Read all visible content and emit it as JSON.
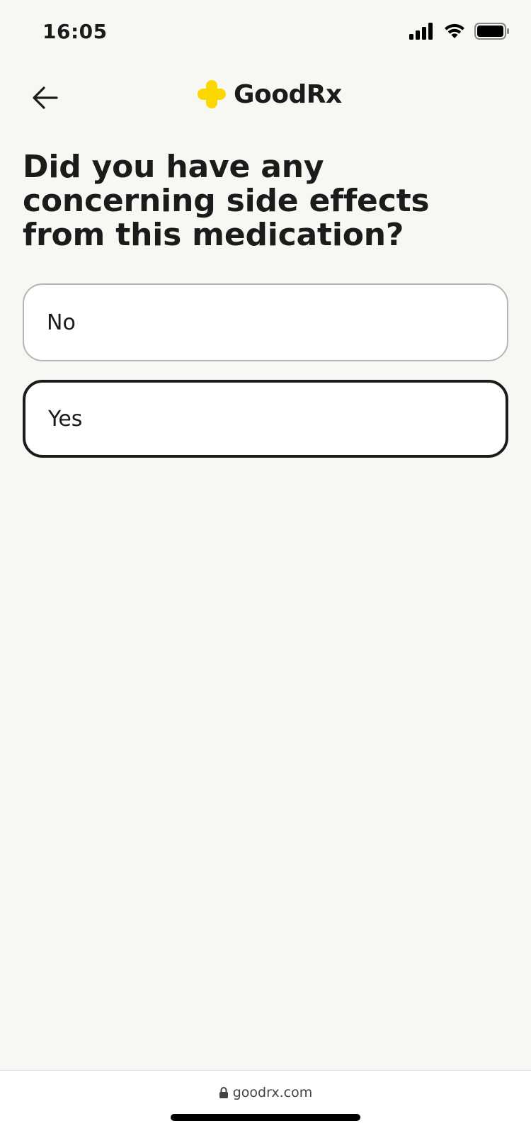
{
  "status_bar": {
    "time": "16:05",
    "icons": [
      "signal-icon",
      "wifi-icon",
      "battery-icon"
    ]
  },
  "header": {
    "back_icon": "arrow-left-icon",
    "brand_name": "GoodRx",
    "logo_color": "#FDD700"
  },
  "question": {
    "text": "Did you have any concerning side effects from this medication?"
  },
  "options": [
    {
      "label": "No",
      "selected": false
    },
    {
      "label": "Yes",
      "selected": true
    }
  ],
  "browser": {
    "url": "goodrx.com",
    "lock_icon": "lock-icon"
  },
  "colors": {
    "background": "#F7F7F3",
    "text": "#1B1B1B",
    "brand_yellow": "#FDD700"
  }
}
